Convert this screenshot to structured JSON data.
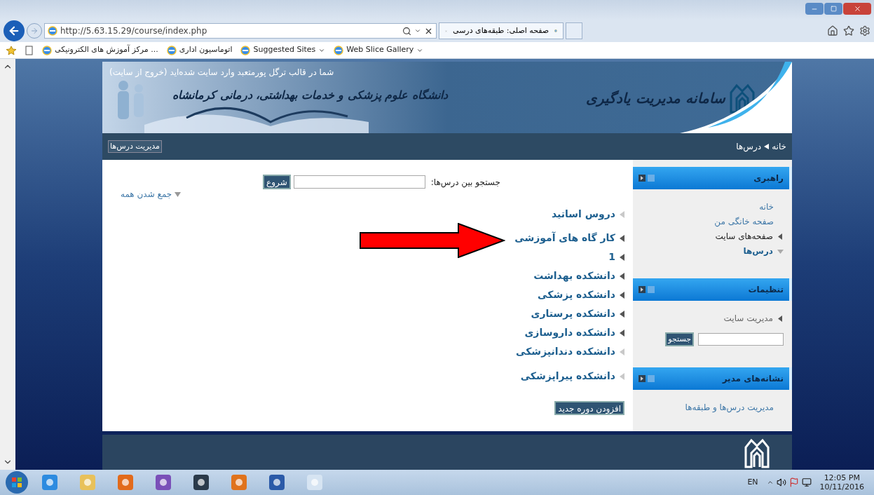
{
  "browser": {
    "address": "http://5.63.15.29/course/index.php",
    "tab": {
      "title": "صفحه اصلی: طبقه‌های درسی",
      "selected": true
    },
    "favorites": [
      {
        "label": "Web Slice Gallery",
        "dropdown": true
      },
      {
        "label": "Suggested Sites",
        "dropdown": true
      },
      {
        "label": "اتوماسیون اداری",
        "dropdown": false
      },
      {
        "label": "مرکز آموزش های الکترونیکی ...",
        "dropdown": false
      }
    ]
  },
  "header": {
    "login_notice": "شما در قالب ترگل پورمتعبد وارد سایت شده‌اید",
    "logout_link": "(خروج از سایت)",
    "university_name": "دانشگاه علوم پزشکی و خدمات بهداشتی، درمانی کرمانشاه",
    "system_name": "سامانه مدیریت یادگیری"
  },
  "navbar": {
    "breadcrumb": [
      "خانه",
      "درس‌ها"
    ],
    "button": "مدیریت درس‌ها"
  },
  "main": {
    "search_label": "جستجو بین درس‌ها:",
    "search_button": "شروع",
    "collapse_all": "جمع شدن همه",
    "categories": [
      {
        "label": "دروس اساتید",
        "expandable": false
      },
      {
        "label": "کار گاه های آموزشی",
        "expandable": true
      },
      {
        "label": "1",
        "expandable": true
      },
      {
        "label": "دانشکده بهداشت",
        "expandable": true
      },
      {
        "label": "دانشکده پزشکی",
        "expandable": true
      },
      {
        "label": "دانشکده پرستاری",
        "expandable": true
      },
      {
        "label": "دانشکده داروسازی",
        "expandable": true
      },
      {
        "label": "دانشکده دندانپزشکی",
        "expandable": false
      },
      {
        "label": "دانشکده پیراپزشکی",
        "expandable": false
      }
    ],
    "add_button": "افزودن دوره جدید"
  },
  "sidebar": [
    {
      "title": "راهبری",
      "items": [
        {
          "label": "خانه",
          "kind": "link"
        },
        {
          "label": "صفحه خانگی من",
          "kind": "link"
        },
        {
          "label": "صفحه‌های سایت",
          "kind": "branch",
          "expanded": false
        },
        {
          "label": "درس‌ها",
          "kind": "branch",
          "expanded": true
        }
      ]
    },
    {
      "title": "تنظیمات",
      "items": [
        {
          "label": "مدیریت سایت",
          "kind": "branch",
          "expanded": false
        },
        {
          "kind": "search",
          "button": "جستجو"
        }
      ]
    },
    {
      "title": "نشانه‌های مدیر",
      "items": [
        {
          "label": "مدیریت درس‌ها و طبقه‌ها",
          "kind": "link"
        }
      ]
    }
  ],
  "taskbar": {
    "language": "EN",
    "time": "12:05 PM",
    "date": "10/11/2016"
  }
}
